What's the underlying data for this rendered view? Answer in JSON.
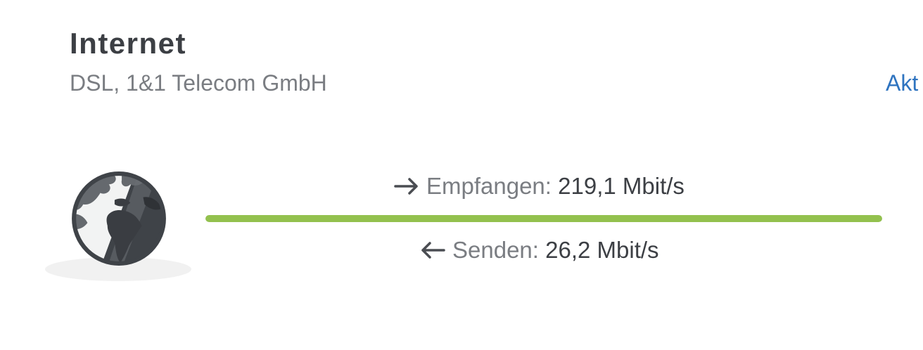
{
  "header": {
    "title": "Internet",
    "subtitle": "DSL, 1&1 Telecom GmbH",
    "action_label": "Akt"
  },
  "connection": {
    "icon": "globe-icon",
    "download": {
      "icon": "arrow-right-icon",
      "label": "Empfangen:",
      "value": "219,1 Mbit/s"
    },
    "upload": {
      "icon": "arrow-left-icon",
      "label": "Senden:",
      "value": "26,2 Mbit/s"
    },
    "bar_fill_fraction": 1.0
  },
  "colors": {
    "title": "#3c3f44",
    "secondary_text": "#7a7d82",
    "link": "#2f74c0",
    "bar": "#93c14e",
    "globe_dark": "#3f4348",
    "globe_light": "#f2f3f3"
  }
}
